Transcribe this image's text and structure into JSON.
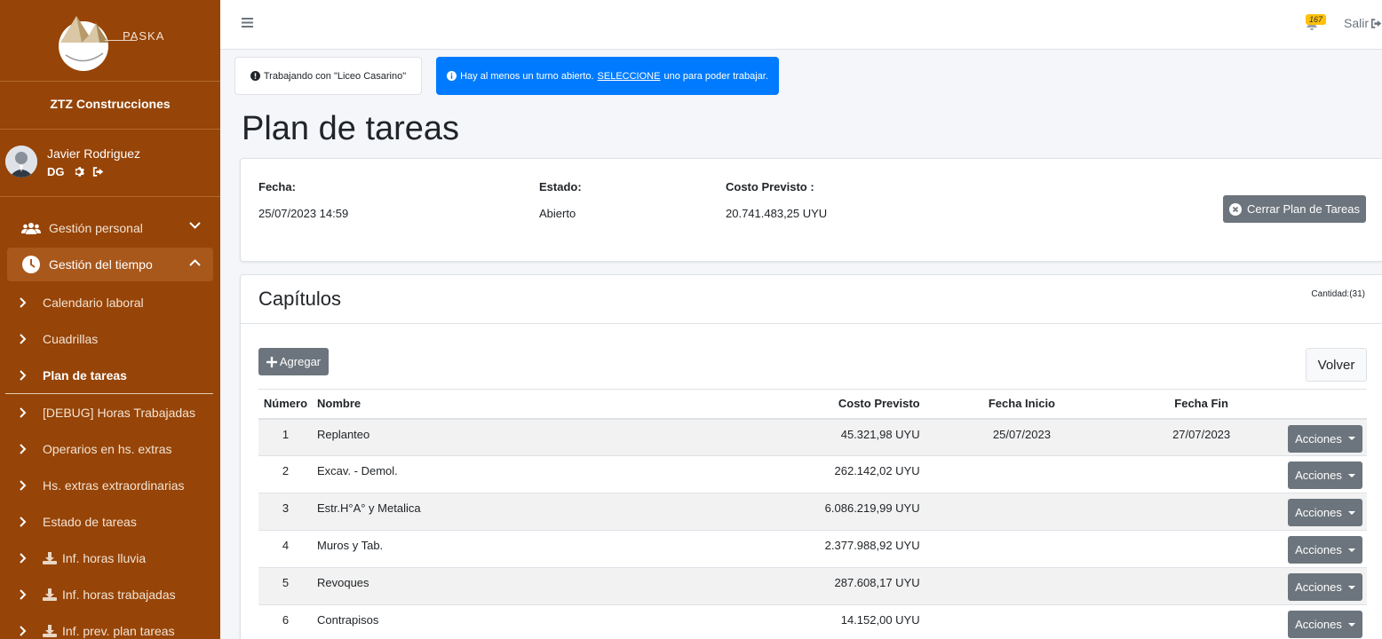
{
  "brand": {
    "name": "PASKA"
  },
  "company": "ZTZ Construcciones",
  "user": {
    "name": "Javier Rodriguez",
    "role": "DG"
  },
  "nav": {
    "gestion_personal": "Gestión personal",
    "gestion_tiempo": "Gestión del tiempo",
    "sub": [
      "Calendario laboral",
      "Cuadrillas",
      "Plan de tareas",
      "[DEBUG] Horas Trabajadas",
      "Operarios en hs. extras",
      "Hs. extras extraordinarias",
      "Estado de tareas",
      "Inf. horas lluvia",
      "Inf. horas trabajadas",
      "Inf. prev. plan tareas"
    ]
  },
  "topbar": {
    "notifications": "167",
    "logout": "Salir"
  },
  "alerts": {
    "working_with": "Trabajando con \"Liceo Casarino\"",
    "shift_pre": "Hay al menos un turno abierto.",
    "shift_link": "SELECCIONE",
    "shift_post": "uno para poder trabajar."
  },
  "page_title": "Plan de tareas",
  "plan": {
    "fecha_label": "Fecha:",
    "fecha": "25/07/2023 14:59",
    "estado_label": "Estado:",
    "estado": "Abierto",
    "costo_label": "Costo Previsto :",
    "costo": "20.741.483,25 UYU",
    "close_button": "Cerrar Plan de Tareas"
  },
  "chapters": {
    "title": "Capítulos",
    "count": "Cantidad:(31)",
    "add_button": "Agregar",
    "back_button": "Volver",
    "columns": [
      "Número",
      "Nombre",
      "Costo Previsto",
      "Fecha Inicio",
      "Fecha Fin"
    ],
    "actions_label": "Acciones",
    "rows": [
      {
        "num": "1",
        "name": "Replanteo",
        "cost": "45.321,98 UYU",
        "start": "25/07/2023",
        "end": "27/07/2023"
      },
      {
        "num": "2",
        "name": "Excav. - Demol.",
        "cost": "262.142,02 UYU",
        "start": "",
        "end": ""
      },
      {
        "num": "3",
        "name": "Estr.H°A° y Metalica",
        "cost": "6.086.219,99 UYU",
        "start": "",
        "end": ""
      },
      {
        "num": "4",
        "name": "Muros y Tab.",
        "cost": "2.377.988,92 UYU",
        "start": "",
        "end": ""
      },
      {
        "num": "5",
        "name": "Revoques",
        "cost": "287.608,17 UYU",
        "start": "",
        "end": ""
      },
      {
        "num": "6",
        "name": "Contrapisos",
        "cost": "14.152,00 UYU",
        "start": "",
        "end": ""
      }
    ]
  }
}
